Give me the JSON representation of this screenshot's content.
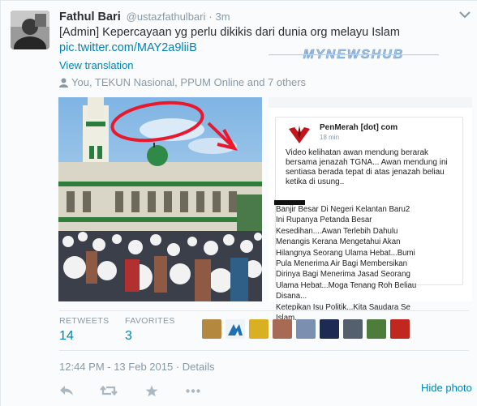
{
  "tweet": {
    "fullname": "Fathul Bari",
    "username": "@ustazfathulbari",
    "separator": "·",
    "time": "3m",
    "text_before_link": "[Admin] Kepercayaan yg perlu dikikis dari dunia org melayu Islam",
    "link": "pic.twitter.com/MAY2a9liiB",
    "translate": "View translation",
    "context": "You, TEKUN Nasional, PPUM Online and 7 others",
    "watermark": "MYNEWSHUB"
  },
  "screenshot": {
    "page_name": "PenMerah [dot] com",
    "post_time": "18 min",
    "post_text": "Video kelihatan awan mendung berarak bersama jenazah TGNA... Awan mendung ini sentiasa berada tepat di atas jenazah beliau ketika di usung..",
    "caption": "Banjir Besar Di Negeri Kelantan Baru2\nIni Rupanya Petanda Besar\nKesedihan....Awan Terlebih Dahulu\nMenangis Kerana Mengetahui Akan\nHilangnya Seorang Ulama Hebat...Bumi\nPula Menerima Air Bagi Membersikan\nDirinya Bagi Menerima Jasad Seorang\nUlama Hebat...Moga Tenang Roh Beliau\nDisana...\nKetepikan Isu Politik...Kita Saudara Se\nIslam.."
  },
  "stats": {
    "retweets_label": "RETWEETS",
    "retweets_count": "14",
    "favorites_label": "FAVORITES",
    "favorites_count": "3"
  },
  "footer": {
    "timestamp": "12:44 PM - 13 Feb 2015",
    "details_sep": "·",
    "details": "Details",
    "hide_photo": "Hide photo"
  },
  "colors": {
    "link": "#0084b4",
    "muted": "#8899a6",
    "text": "#292f33"
  },
  "icons": [
    "user-icon",
    "chevron-down-icon",
    "reply-icon",
    "retweet-icon",
    "favorite-icon",
    "more-icon"
  ]
}
